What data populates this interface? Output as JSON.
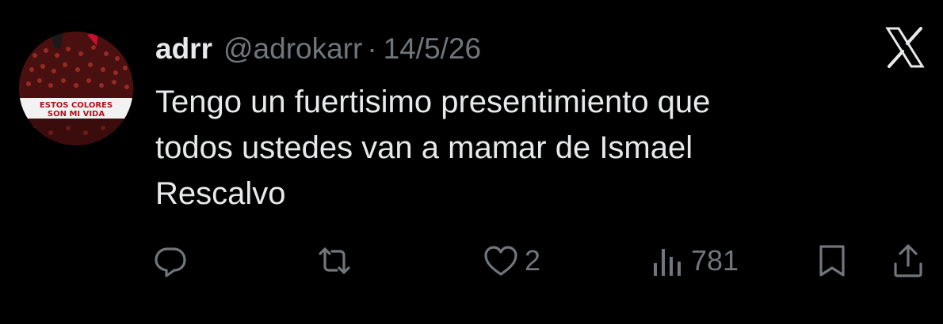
{
  "tweet": {
    "display_name": "adrr",
    "handle": "@adrokarr",
    "separator": "·",
    "date": "14/5/26",
    "text_lines": [
      "Tengo un fuertisimo presentimiento que",
      "todos ustedes van a mamar de Ismael",
      "Rescalvo"
    ],
    "avatar_banner_line1": "ESTOS COLORES",
    "avatar_banner_line2": "SON MI VIDA"
  },
  "actions": {
    "reply_icon": "reply-icon",
    "retweet_icon": "retweet-icon",
    "like_icon": "heart-icon",
    "like_count": "2",
    "views_icon": "views-icon",
    "views_count": "781",
    "bookmark_icon": "bookmark-icon",
    "share_icon": "share-icon"
  },
  "colors": {
    "background": "#000000",
    "text_primary": "#e7e9ea",
    "text_secondary": "#71767b",
    "accent_red": "#c8102e"
  }
}
